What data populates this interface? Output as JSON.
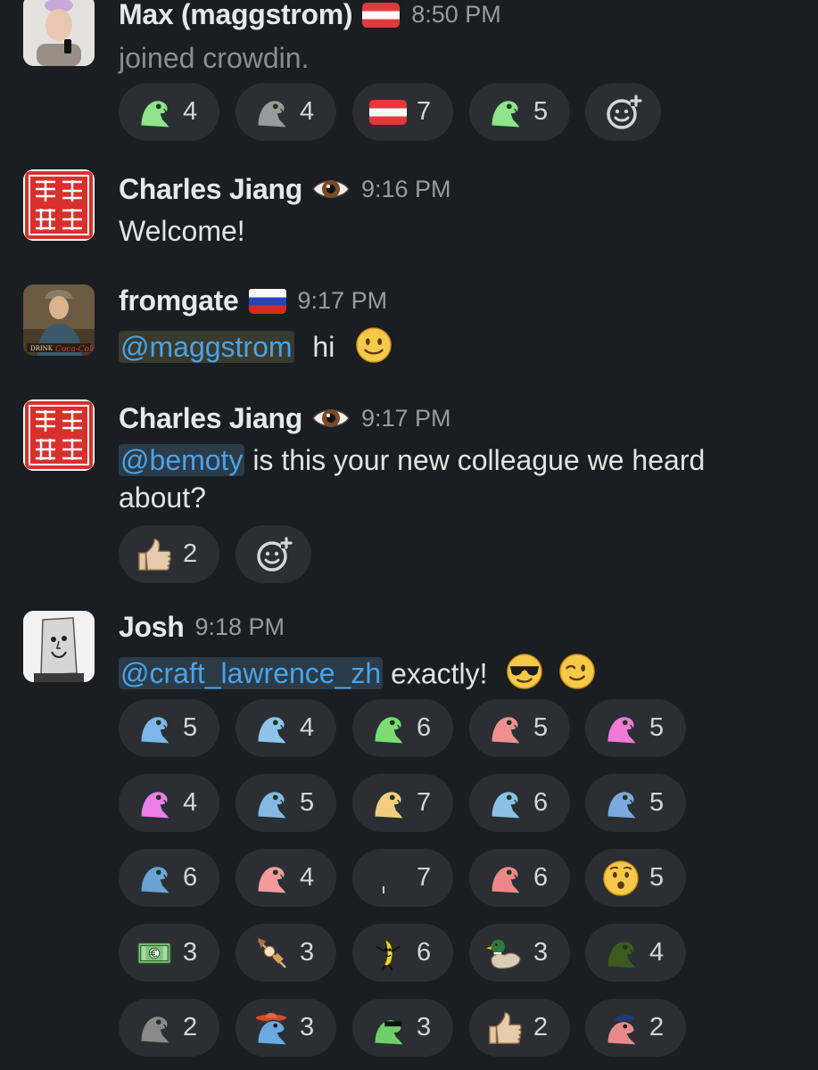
{
  "colors": {
    "background": "#1a1d21",
    "pill": "#2c2e33",
    "mention": "#4aa3e8",
    "time": "#9a9b9e"
  },
  "messages": [
    {
      "name": "Max (maggstrom)",
      "badge_icon": "austria-flag-icon",
      "time": "8:50 PM",
      "text": "joined crowdin.",
      "avatar_icon": "photo-avatar",
      "reactions": [
        {
          "icon": "green-parrot-icon",
          "count": "4"
        },
        {
          "icon": "gray-parrot-icon",
          "count": "4"
        },
        {
          "icon": "austria-flag-icon",
          "count": "7"
        },
        {
          "icon": "green-parrot-wave-icon",
          "count": "5"
        }
      ],
      "add_reaction_icon": "add-reaction-icon"
    },
    {
      "name": "Charles Jiang",
      "badge_icon": "eye-icon",
      "time": "9:16 PM",
      "text": "Welcome!",
      "avatar_icon": "red-seal-avatar"
    },
    {
      "name": "fromgate",
      "badge_icon": "russia-flag-icon",
      "time": "9:17 PM",
      "mention": "@maggstrom",
      "text": " hi",
      "inline_emoji": "slightly-smiling-face-icon",
      "avatar_icon": "vintage-poster-avatar"
    },
    {
      "name": "Charles Jiang",
      "badge_icon": "eye-icon",
      "time": "9:17 PM",
      "mention": "@bemoty",
      "text": " is this your new colleague we heard about?",
      "avatar_icon": "red-seal-avatar",
      "reactions": [
        {
          "icon": "thumbs-up-icon",
          "count": "2"
        }
      ],
      "add_reaction_icon": "add-reaction-icon"
    },
    {
      "name": "Josh",
      "time": "9:18 PM",
      "mention": "@craft_lawrence_zh",
      "text": " exactly!",
      "inline_emojis": [
        "sunglasses-face-icon",
        "winking-face-icon"
      ],
      "avatar_icon": "paper-bag-avatar",
      "reactions": [
        {
          "icon": "blue-parrot-icon",
          "count": "5"
        },
        {
          "icon": "blue-parrot-icon",
          "count": "4"
        },
        {
          "icon": "green-parrot-icon",
          "count": "6"
        },
        {
          "icon": "pink-parrot-icon",
          "count": "5"
        },
        {
          "icon": "magenta-parrot-icon",
          "count": "5"
        },
        {
          "icon": "magenta-parrot-icon",
          "count": "4"
        },
        {
          "icon": "blue-parrot-icon",
          "count": "5"
        },
        {
          "icon": "yellow-parrot-wave-icon",
          "count": "7"
        },
        {
          "icon": "blue-parrot-icon",
          "count": "6"
        },
        {
          "icon": "blue-parrot-icon",
          "count": "5"
        },
        {
          "icon": "blue-parrot-flat-icon",
          "count": "6"
        },
        {
          "icon": "pink-parrot-icon",
          "count": "4"
        },
        {
          "icon": "blank-parrot-icon",
          "count": "7"
        },
        {
          "icon": "pink-parrot-icon",
          "count": "6"
        },
        {
          "icon": "hushed-face-icon",
          "count": "5"
        },
        {
          "icon": "euro-banknote-icon",
          "count": "3"
        },
        {
          "icon": "oden-icon",
          "count": "3"
        },
        {
          "icon": "dancing-banana-icon",
          "count": "6"
        },
        {
          "icon": "duck-icon",
          "count": "3"
        },
        {
          "icon": "dark-green-parrot-icon",
          "count": "4"
        },
        {
          "icon": "gray-parrot-icon",
          "count": "2"
        },
        {
          "icon": "sombrero-parrot-icon",
          "count": "3"
        },
        {
          "icon": "sunglasses-parrot-icon",
          "count": "3"
        },
        {
          "icon": "thumbs-up-icon",
          "count": "2"
        },
        {
          "icon": "police-parrot-icon",
          "count": "2"
        }
      ]
    }
  ]
}
